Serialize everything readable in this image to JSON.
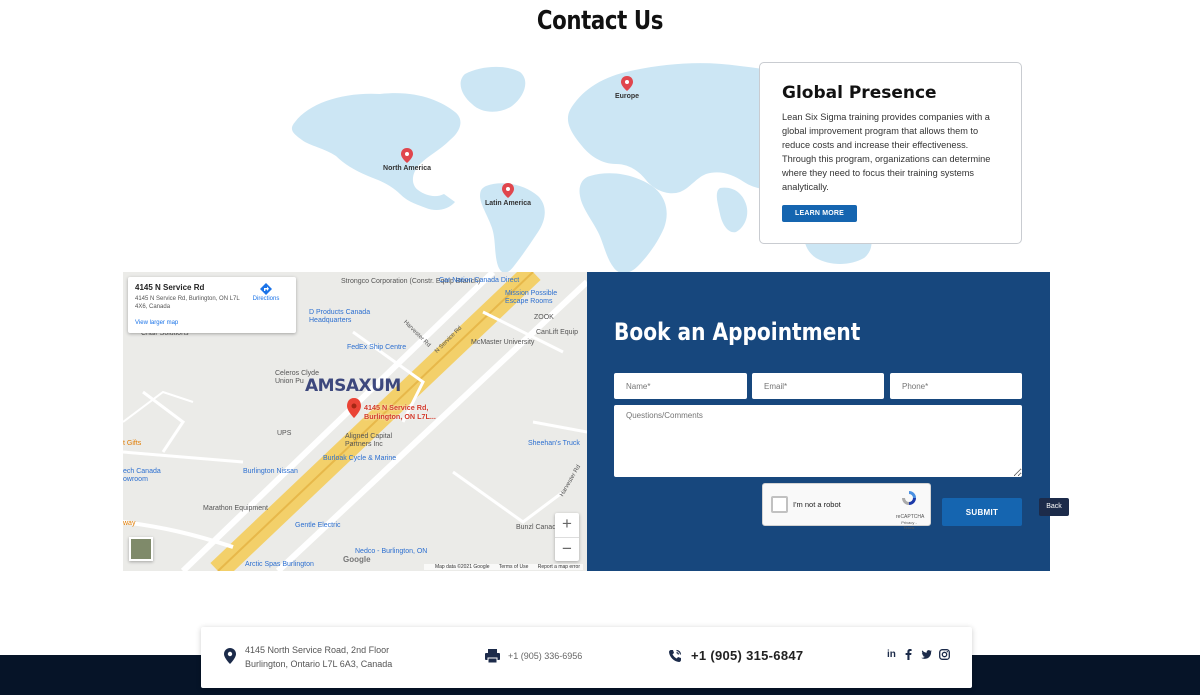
{
  "page": {
    "title": "Contact Us"
  },
  "world_map": {
    "pins": [
      {
        "label": "Europe"
      },
      {
        "label": "North America"
      },
      {
        "label": "Latin America"
      }
    ],
    "colors": {
      "land": "#cce6f4",
      "pin": "#e0464d"
    }
  },
  "presence_card": {
    "heading": "Global Presence",
    "body": "Lean Six Sigma training provides companies with a global improvement program that allows them to reduce costs and increase their effectiveness. Through this program, organizations can determine where they need to focus their training systems analytically.",
    "button_label": "LEARN MORE"
  },
  "map": {
    "info": {
      "title": "4145 N Service Rd",
      "address": "4145 N Service Rd, Burlington, ON L7L 4X6, Canada",
      "directions": "Directions",
      "view_larger": "View larger map"
    },
    "marker_label_1": "4145 N Service Rd,",
    "marker_label_2": "Burlington, ON L7L...",
    "logo_text": "AMSAXUM",
    "pois": [
      "Strongco Corporation (Constr. Equip Branch)",
      "Car Nation Canada Direct",
      "Mission Possible Escape Rooms",
      "D Products Canada Headquarters",
      "ZOOK",
      "CanLift Equip",
      "FedEx Ship Centre",
      "McMaster University",
      "Chair Solutions",
      "Celeros Clyde Union Pu",
      "UPS",
      "Aligned Capital Partners Inc",
      "Burloak Cycle & Marine",
      "Sheehan's Truck",
      "t Gifts",
      "ech Canada owroom",
      "Burlington Nissan",
      "Marathon Equipment",
      "Gentle Electric",
      "Bunzl Canad",
      "way",
      "Nedco - Burlington, ON",
      "Arctic Spas Burlington",
      "N Service Rd",
      "Harvester Rd",
      "Harvester Rd"
    ],
    "google": "Google",
    "footer": [
      "Map data ©2021 Google",
      "Terms of Use",
      "Report a map error"
    ],
    "zoom_in": "+",
    "zoom_out": "−"
  },
  "appointment": {
    "title": "Book an Appointment",
    "name_placeholder": "Name*",
    "email_placeholder": "Email*",
    "phone_placeholder": "Phone*",
    "comments_placeholder": "Questions/Comments",
    "recaptcha_label": "I'm not a robot",
    "recaptcha_brand": "reCAPTCHA",
    "recaptcha_links": "Privacy - Terms",
    "submit_label": "SUBMIT",
    "back_label": "Back",
    "colors": {
      "panel": "#17477d",
      "button": "#1565b0"
    }
  },
  "footer": {
    "address_line1": "4145 North Service Road, 2nd Floor",
    "address_line2": "Burlington, Ontario  L7L 6A3, Canada",
    "fax": "+1 (905) 336-6956",
    "phone": "+1 (905) 315-6847",
    "social": [
      "linkedin-icon",
      "facebook-icon",
      "twitter-icon",
      "instagram-icon"
    ],
    "linkedin_text": "in",
    "colors": {
      "bar": "#061428"
    }
  }
}
